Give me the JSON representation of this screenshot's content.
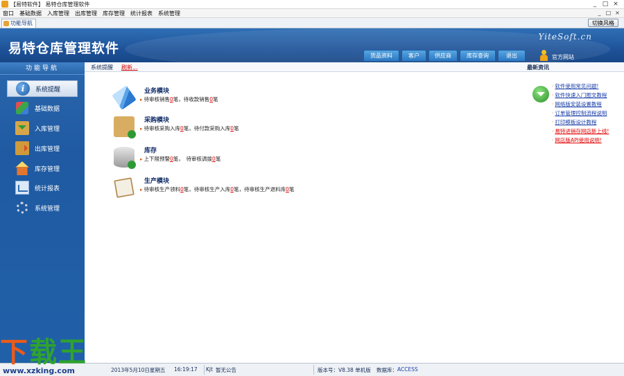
{
  "window": {
    "title": "【易特软件】 易特仓库管理软件",
    "controls": [
      "_",
      "□",
      "×"
    ]
  },
  "menu": [
    "窗口",
    "基础数据",
    "入库管理",
    "出库管理",
    "库存管理",
    "统计报表",
    "系统管理"
  ],
  "mdi_controls": [
    "_",
    "□",
    "×"
  ],
  "tabs": {
    "func_nav": "功能导航",
    "switch_skin": "切换风格"
  },
  "banner": {
    "brand": "易特仓库管理软件",
    "site": "YiteSoft.cn",
    "buttons": [
      "货品资料",
      "客户",
      "供应商",
      "库存查询",
      "退出"
    ],
    "official_site": "官方网站"
  },
  "subheader": {
    "system_tip": "系统提醒",
    "refresh": "刷新...",
    "news_title": "最新资讯"
  },
  "sidebar": {
    "title": "功能导航",
    "items": [
      "系统提醒",
      "基础数据",
      "入库管理",
      "出库管理",
      "库存管理",
      "统计报表",
      "系统管理"
    ]
  },
  "modules": [
    {
      "title": "业务模块",
      "line": [
        "待审核销售",
        "0",
        "笔，待收款销售",
        "0",
        "笔"
      ]
    },
    {
      "title": "采购模块",
      "line": [
        "待审核采购入库",
        "0",
        "笔，待付款采购入库",
        "0",
        "笔"
      ]
    },
    {
      "title": "库存",
      "line": [
        "上下限预警",
        "0",
        "笔，　待审核调拨",
        "0",
        "笔"
      ]
    },
    {
      "title": "生产模块",
      "line": [
        "待审核生产领料",
        "0",
        "笔，待审核生产入库",
        "0",
        "笔，待审核生产退料库",
        "0",
        "笔"
      ]
    }
  ],
  "news": [
    {
      "text": "软件使用常见问题!",
      "red": false
    },
    {
      "text": "软件快速入门图文教程",
      "red": false
    },
    {
      "text": "网络版安装设置教程",
      "red": false
    },
    {
      "text": "订单管理控制流程说明",
      "red": false
    },
    {
      "text": "打印模板设计教程",
      "red": false
    },
    {
      "text": "易特进销存网店新上线!",
      "red": true
    },
    {
      "text": "网店版API使用说明!",
      "red": true
    }
  ],
  "status": {
    "date": "2013年5月10日",
    "weekday": "星期五",
    "time": "16:19:17",
    "notice_prefix": "Kjt",
    "notice": "暂无公告",
    "version": "版本号：V8.38 单机版",
    "db_label": "数据库：",
    "db_value": "ACCESS"
  },
  "watermark": {
    "logo_k": "下",
    "logo_rest": "载王",
    "url": "www.xzking.com"
  }
}
